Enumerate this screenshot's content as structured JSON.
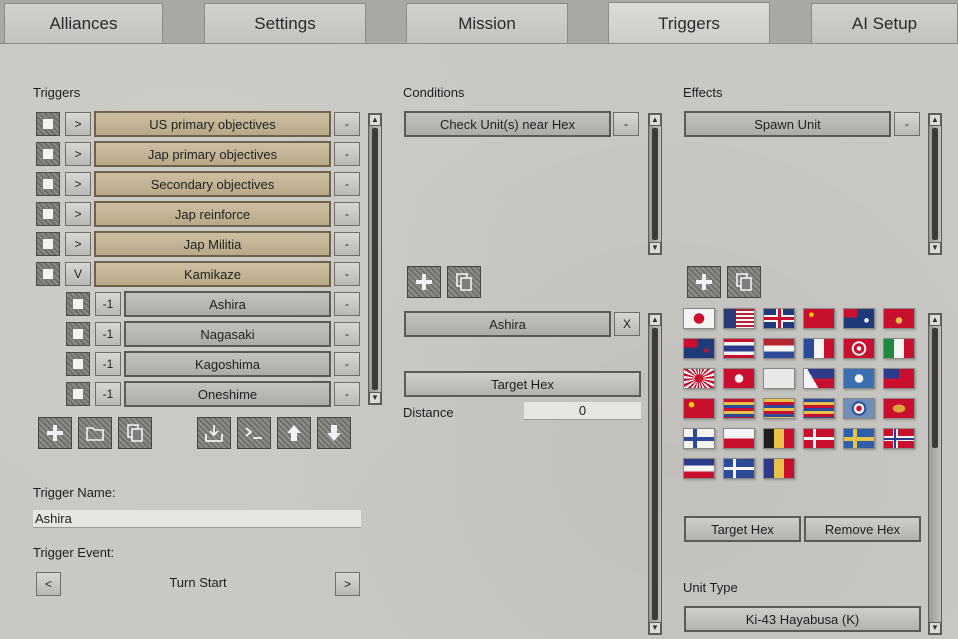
{
  "tabs": [
    {
      "label": "Alliances",
      "active": false
    },
    {
      "label": "Settings",
      "active": false
    },
    {
      "label": "Mission",
      "active": false
    },
    {
      "label": "Triggers",
      "active": true
    },
    {
      "label": "AI Setup",
      "active": false
    }
  ],
  "triggers": {
    "heading": "Triggers",
    "rows": [
      {
        "toggle": ">",
        "name": "US primary objectives",
        "remove": "-",
        "child": false
      },
      {
        "toggle": ">",
        "name": "Jap primary objectives",
        "remove": "-",
        "child": false
      },
      {
        "toggle": ">",
        "name": "Secondary objectives",
        "remove": "-",
        "child": false
      },
      {
        "toggle": ">",
        "name": "Jap reinforce",
        "remove": "-",
        "child": false
      },
      {
        "toggle": ">",
        "name": "Jap Militia",
        "remove": "-",
        "child": false
      },
      {
        "toggle": "V",
        "name": "Kamikaze",
        "remove": "-",
        "child": false
      },
      {
        "toggle": "-1",
        "name": "Ashira",
        "remove": "-",
        "child": true
      },
      {
        "toggle": "-1",
        "name": "Nagasaki",
        "remove": "-",
        "child": true
      },
      {
        "toggle": "-1",
        "name": "Kagoshima",
        "remove": "-",
        "child": true
      },
      {
        "toggle": "-1",
        "name": "Oneshime",
        "remove": "-",
        "child": true
      }
    ],
    "toolbar": [
      "plus-icon",
      "folder-icon",
      "copy-icon",
      "import-icon",
      "console-icon",
      "arrow-up-icon",
      "arrow-down-icon"
    ],
    "name_label": "Trigger Name:",
    "name_value": "Ashira",
    "event_label": "Trigger Event:",
    "event_prev": "<",
    "event_value": "Turn Start",
    "event_next": ">"
  },
  "conditions": {
    "heading": "Conditions",
    "items": [
      {
        "name": "Check Unit(s) near Hex",
        "remove": "-"
      }
    ],
    "selected_name": "Ashira",
    "clear": "X",
    "target_hex": "Target Hex",
    "distance_label": "Distance",
    "distance_value": "0"
  },
  "effects": {
    "heading": "Effects",
    "items": [
      {
        "name": "Spawn Unit",
        "remove": "-"
      }
    ],
    "target_hex": "Target Hex",
    "remove_hex": "Remove Hex",
    "unit_type_label": "Unit Type",
    "unit_type_value": "Ki-43 Hayabusa (K)"
  },
  "flags": [
    "japan-flag",
    "usa-flag",
    "uk-flag",
    "ussr-flag",
    "australia-flag",
    "pacific-flag",
    "nz-flag",
    "thailand-flag",
    "netherlands-flag",
    "france-flag",
    "finland-roundel-flag",
    "italy-flag",
    "rising-sun-flag",
    "manchukuo-flag",
    "china-white-flag",
    "philippines-flag",
    "star-flag",
    "roc-flag",
    "prc-flag",
    "stripes-flag-a",
    "stripes-flag-b",
    "stripes-flag-c",
    "roundel-flag",
    "insignia-flag",
    "finland-flag",
    "poland-flag",
    "belgium-flag",
    "denmark-flag",
    "sweden-flag",
    "norway-flag",
    "france-stripes-flag",
    "cross-flag",
    "romania-flag"
  ],
  "colors": {
    "tan_bar": "#c2b394",
    "gray_bar": "#b8b7b3",
    "panel": "#c9c8c4"
  }
}
